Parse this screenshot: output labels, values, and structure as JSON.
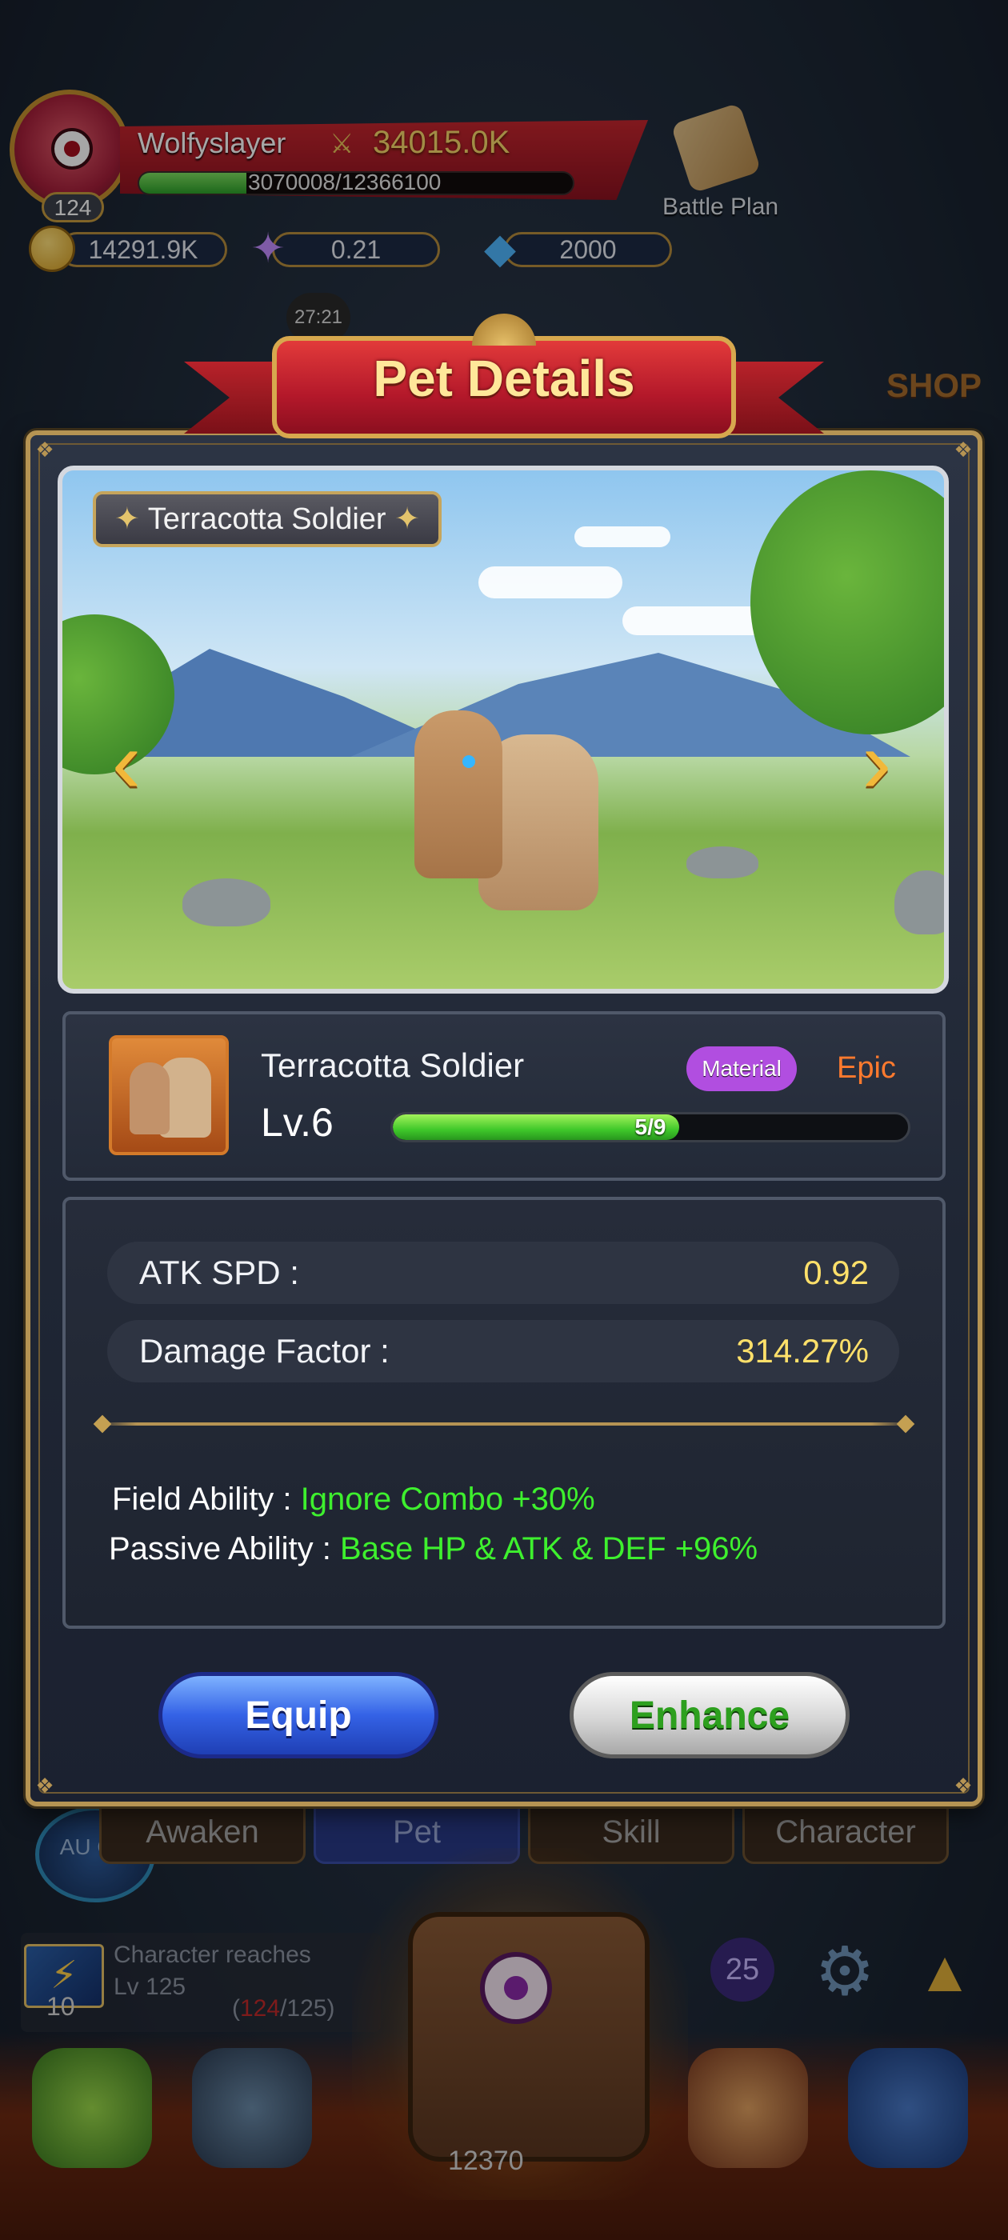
{
  "hud": {
    "player_name": "Wolfyslayer",
    "power": "34015.0K",
    "level": "124",
    "xp_text": "3070008/12366100",
    "xp_fraction": 0.248,
    "gold": "14291.9K",
    "stars": "0.21",
    "gems": "2000",
    "battle_plan_label": "Battle Plan",
    "timer": "27:21",
    "icons": {
      "power": "crossed-swords-icon",
      "gold": "coin-icon",
      "stars": "star-icon",
      "gems": "gem-icon",
      "battle_plan": "scroll-icon"
    }
  },
  "popup": {
    "title": "Pet Details",
    "scene_tag": "Terracotta Soldier",
    "pet_name": "Terracotta Soldier",
    "material_badge": "Material",
    "rarity": "Epic",
    "level_label": "Lv.6",
    "level_progress_text": "5/9",
    "level_progress_fraction": 0.556,
    "stats": [
      {
        "label": "ATK SPD :",
        "value": "0.92"
      },
      {
        "label": "Damage Factor :",
        "value": "314.27%"
      }
    ],
    "field_ability_label": "Field Ability :",
    "field_ability_value": "Ignore Combo +30%",
    "passive_ability_label": "Passive Ability :",
    "passive_ability_value": "Base HP & ATK & DEF +96%",
    "equip_label": "Equip",
    "enhance_label": "Enhance",
    "colors": {
      "rarity_epic": "#ff7a2e",
      "ability_value": "#3ef02e",
      "stat_value": "#ffe06a",
      "material_badge": "#b14ee0"
    }
  },
  "background_ui": {
    "tabs": [
      "Awaken",
      "Pet",
      "Skill",
      "Character"
    ],
    "active_tab": "Pet",
    "auto_label": "AU ON",
    "quest": {
      "text_line1": "Character reaches",
      "text_line2": "Lv 125",
      "count": "10",
      "progress_open": "(",
      "progress_current": "124",
      "progress_rest": "/125)"
    },
    "badge_count": "25",
    "gold_bottom": "12370",
    "shop_label": "SHOP"
  }
}
